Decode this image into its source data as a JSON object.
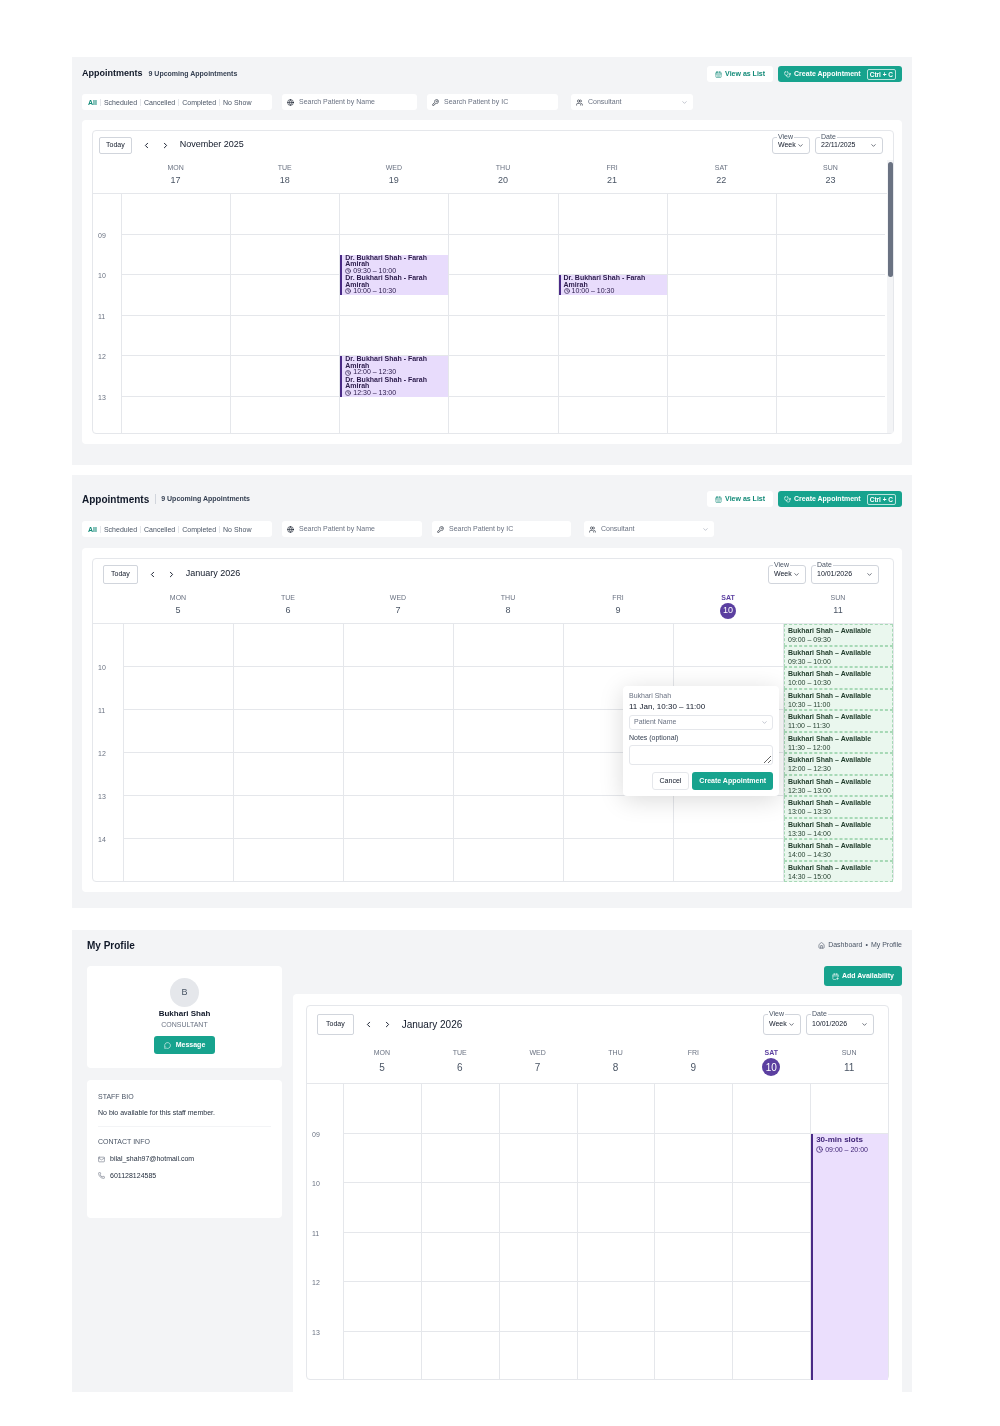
{
  "appointment_views": [
    {
      "title": "Appointments",
      "count": "9 Upcoming Appointments",
      "view_list_button": "View as List",
      "create_button": {
        "label": "Create Appointment",
        "shortcut": "Ctrl + C"
      },
      "status_filters": [
        {
          "label": "All",
          "selected": true
        },
        {
          "label": "Scheduled",
          "selected": false
        },
        {
          "label": "Cancelled",
          "selected": false
        },
        {
          "label": "Completed",
          "selected": false
        },
        {
          "label": "No Show",
          "selected": false
        }
      ],
      "search_name": {
        "placeholder": "Search Patient by Name"
      },
      "search_ic": {
        "placeholder": "Search Patient by IC"
      },
      "consultant": {
        "placeholder": "Consultant"
      },
      "calendar": {
        "today_button": "Today",
        "month": "November 2025",
        "view": {
          "label": "View",
          "value": "Week"
        },
        "date": {
          "label": "Date",
          "value": "22/11/2025"
        },
        "hour_labels": [
          "09",
          "10",
          "11",
          "12",
          "13"
        ],
        "days": [
          {
            "weekday": "MON",
            "date": "17",
            "selected": false
          },
          {
            "weekday": "TUE",
            "date": "18",
            "selected": false
          },
          {
            "weekday": "WED",
            "date": "19",
            "selected": false,
            "events": [
              {
                "kind": "appointment",
                "title": "Dr. Bukhari Shah - Farah Amirah",
                "time": "09:30 – 10:00"
              },
              {
                "kind": "appointment",
                "title": "Dr. Bukhari Shah - Farah Amirah",
                "time": "10:00 – 10:30"
              },
              {
                "kind": "appointment",
                "title": "Dr. Bukhari Shah - Farah Amirah",
                "time": "12:00 – 12:30"
              },
              {
                "kind": "appointment",
                "title": "Dr. Bukhari Shah - Farah Amirah",
                "time": "12:30 – 13:00"
              }
            ]
          },
          {
            "weekday": "THU",
            "date": "20",
            "selected": false
          },
          {
            "weekday": "FRI",
            "date": "21",
            "selected": false,
            "events": [
              {
                "kind": "appointment",
                "title": "Dr. Bukhari Shah - Farah Amirah",
                "time": "10:00 – 10:30"
              }
            ]
          },
          {
            "weekday": "SAT",
            "date": "22",
            "selected": false
          },
          {
            "weekday": "SUN",
            "date": "23",
            "selected": false
          }
        ]
      }
    },
    {
      "title": "Appointments",
      "count": "9 Upcoming Appointments",
      "view_list_button": "View as List",
      "create_button": {
        "label": "Create Appointment",
        "shortcut": "Ctrl + C"
      },
      "status_filters": [
        {
          "label": "All",
          "selected": true
        },
        {
          "label": "Scheduled",
          "selected": false
        },
        {
          "label": "Cancelled",
          "selected": false
        },
        {
          "label": "Completed",
          "selected": false
        },
        {
          "label": "No Show",
          "selected": false
        }
      ],
      "search_name": {
        "placeholder": "Search Patient by Name"
      },
      "search_ic": {
        "placeholder": "Search Patient by IC"
      },
      "consultant": {
        "placeholder": "Consultant"
      },
      "calendar": {
        "today_button": "Today",
        "month": "January 2026",
        "view": {
          "label": "View",
          "value": "Week"
        },
        "date": {
          "label": "Date",
          "value": "10/01/2026"
        },
        "hour_labels": [
          "10",
          "11",
          "12",
          "13",
          "14"
        ],
        "days": [
          {
            "weekday": "MON",
            "date": "5",
            "selected": false
          },
          {
            "weekday": "TUE",
            "date": "6",
            "selected": false
          },
          {
            "weekday": "WED",
            "date": "7",
            "selected": false
          },
          {
            "weekday": "THU",
            "date": "8",
            "selected": false
          },
          {
            "weekday": "FRI",
            "date": "9",
            "selected": false
          },
          {
            "weekday": "SAT",
            "date": "10",
            "selected": true
          },
          {
            "weekday": "SUN",
            "date": "11",
            "selected": false,
            "events": [
              {
                "kind": "available",
                "title": "Bukhari Shah – Available",
                "time": "09:00 – 09:30"
              },
              {
                "kind": "available",
                "title": "Bukhari Shah – Available",
                "time": "09:30 – 10:00"
              },
              {
                "kind": "available",
                "title": "Bukhari Shah – Available",
                "time": "10:00 – 10:30"
              },
              {
                "kind": "available",
                "title": "Bukhari Shah – Available",
                "time": "10:30 – 11:00"
              },
              {
                "kind": "available",
                "title": "Bukhari Shah – Available",
                "time": "11:00 – 11:30"
              },
              {
                "kind": "available",
                "title": "Bukhari Shah – Available",
                "time": "11:30 – 12:00"
              },
              {
                "kind": "available",
                "title": "Bukhari Shah – Available",
                "time": "12:00 – 12:30"
              },
              {
                "kind": "available",
                "title": "Bukhari Shah – Available",
                "time": "12:30 – 13:00"
              },
              {
                "kind": "available",
                "title": "Bukhari Shah – Available",
                "time": "13:00 – 13:30"
              },
              {
                "kind": "available",
                "title": "Bukhari Shah – Available",
                "time": "13:30 – 14:00"
              },
              {
                "kind": "available",
                "title": "Bukhari Shah – Available",
                "time": "14:00 – 14:30"
              },
              {
                "kind": "available",
                "title": "Bukhari Shah – Available",
                "time": "14:30 – 15:00"
              }
            ]
          }
        ]
      },
      "popover": {
        "consultant": "Bukhari Shah",
        "slot": "11 Jan, 10:30 – 11:00",
        "patient": {
          "placeholder": "Patient Name"
        },
        "notes_label": "Notes (optional)",
        "cancel_button": "Cancel",
        "create_button": "Create Appointment"
      }
    }
  ],
  "profile": {
    "title": "My Profile",
    "breadcrumb": {
      "items": [
        "Dashboard",
        "My Profile"
      ],
      "separator": "•"
    },
    "avatar_initial": "B",
    "name": "Bukhari Shah",
    "role": "CONSULTANT",
    "message_button": "Message",
    "bio_heading": "STAFF BIO",
    "bio": "No bio available for this staff member.",
    "contact_heading": "CONTACT INFO",
    "email": "bilal_shah97@hotmail.com",
    "phone": "601128124585",
    "add_button": "Add Availability",
    "calendar": {
      "today_button": "Today",
      "month": "January 2026",
      "view": {
        "label": "View",
        "value": "Week"
      },
      "date": {
        "label": "Date",
        "value": "10/01/2026"
      },
      "hour_labels": [
        "09",
        "10",
        "11",
        "12",
        "13"
      ],
      "days": [
        {
          "weekday": "MON",
          "date": "5",
          "selected": false
        },
        {
          "weekday": "TUE",
          "date": "6",
          "selected": false
        },
        {
          "weekday": "WED",
          "date": "7",
          "selected": false
        },
        {
          "weekday": "THU",
          "date": "8",
          "selected": false
        },
        {
          "weekday": "FRI",
          "date": "9",
          "selected": false
        },
        {
          "weekday": "SAT",
          "date": "10",
          "selected": true
        },
        {
          "weekday": "SUN",
          "date": "11",
          "selected": false,
          "events": [
            {
              "kind": "block",
              "title": "30-min slots",
              "time": "09:00 – 20:00"
            }
          ]
        }
      ]
    }
  }
}
